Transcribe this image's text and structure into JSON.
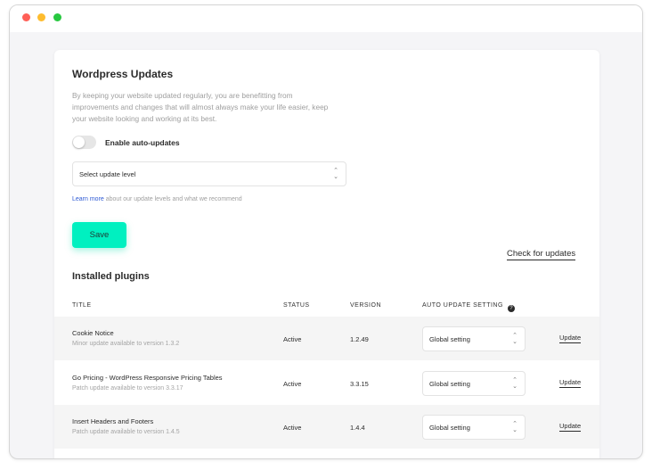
{
  "window": {
    "traffic_lights": [
      "close",
      "minimize",
      "maximize"
    ]
  },
  "updates": {
    "heading": "Wordpress Updates",
    "description": "By keeping your website updated regularly, you are benefitting from improvements and changes that will almost always make your life easier, keep your website looking and working at its best.",
    "auto_update_label": "Enable auto-updates",
    "auto_update_enabled": false,
    "update_level_value": "Select update level",
    "learn_more_link": "Learn more",
    "learn_more_rest": " about our update levels and what we recommend",
    "save_label": "Save",
    "check_updates_label": "Check for updates"
  },
  "plugins": {
    "title": "Installed plugins",
    "columns": {
      "title": "TITLE",
      "status": "STATUS",
      "version": "VERSION",
      "auto_update": "AUTO UPDATE SETTING"
    },
    "rows": [
      {
        "title": "Cookie Notice",
        "subtitle": "Minor update available to version 1.3.2",
        "status": "Active",
        "version": "1.2.49",
        "setting": "Global setting",
        "action": "Update"
      },
      {
        "title": "Go Pricing - WordPress Responsive Pricing Tables",
        "subtitle": "Patch update available to version 3.3.17",
        "status": "Active",
        "version": "3.3.15",
        "setting": "Global setting",
        "action": "Update"
      },
      {
        "title": "Insert Headers and Footers",
        "subtitle": "Patch update available to version 1.4.5",
        "status": "Active",
        "version": "1.4.4",
        "setting": "Global setting",
        "action": "Update"
      }
    ]
  },
  "colors": {
    "accent": "#00f0c0",
    "link": "#2f5bd4"
  }
}
